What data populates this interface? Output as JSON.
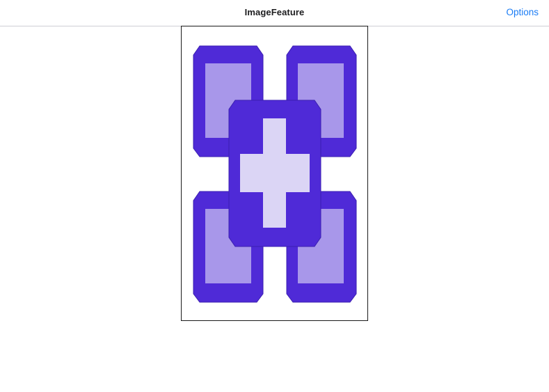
{
  "navbar": {
    "title": "ImageFeature",
    "options_label": "Options"
  },
  "image": {
    "icon": "feature-graphic-icon",
    "colors": {
      "dark_purple": "#4f2ad7",
      "medium_purple": "#a897ea",
      "light_purple": "#dbd5f5",
      "frame_border": "#1a1a1a"
    }
  },
  "colors": {
    "accent": "#1a7cf5",
    "title_text": "#1c1c1e",
    "separator": "#cfcfd4"
  }
}
